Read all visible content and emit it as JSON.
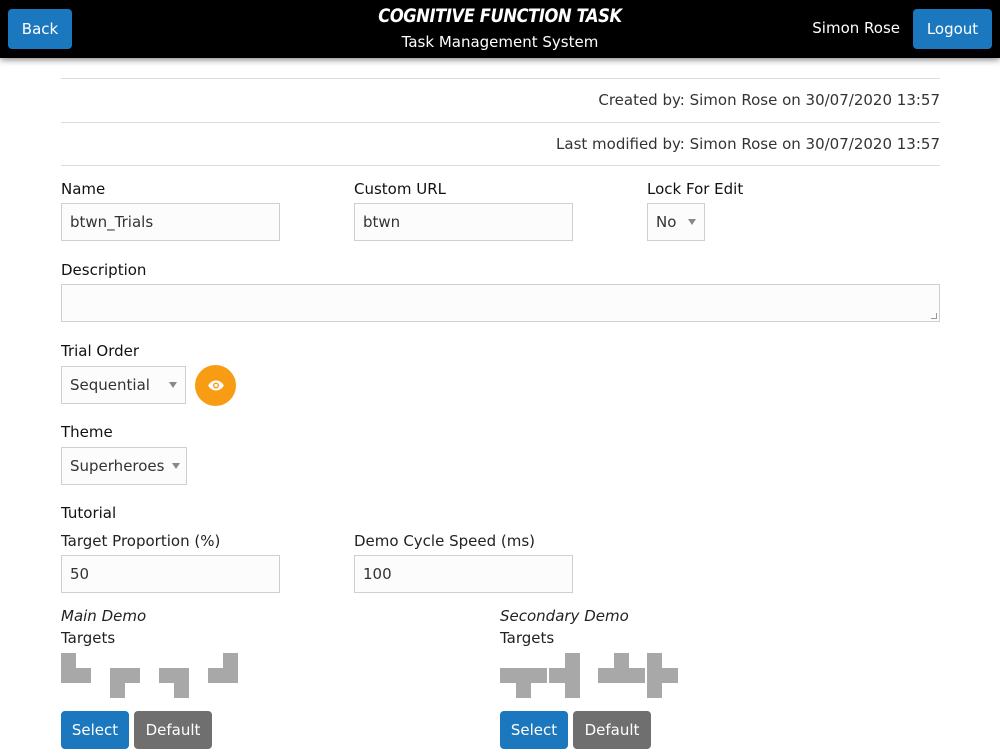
{
  "header": {
    "back_label": "Back",
    "app_title": "COGNITIVE FUNCTION TASK",
    "app_subtitle": "Task Management System",
    "user_name": "Simon Rose",
    "logout_label": "Logout"
  },
  "meta": {
    "created": "Created by: Simon Rose on 30/07/2020 13:57",
    "modified": "Last modified by: Simon Rose on 30/07/2020 13:57"
  },
  "form": {
    "name_label": "Name",
    "name_value": "btwn_Trials",
    "custom_url_label": "Custom URL",
    "custom_url_value": "btwn",
    "lock_label": "Lock For Edit",
    "lock_value": "No",
    "description_label": "Description",
    "description_value": "",
    "trial_order_label": "Trial Order",
    "trial_order_value": "Sequential",
    "theme_label": "Theme",
    "theme_value": "Superheroes",
    "tutorial_label": "Tutorial",
    "target_proportion_label": "Target Proportion (%)",
    "target_proportion_value": "50",
    "demo_speed_label": "Demo Cycle Speed (ms)",
    "demo_speed_value": "100"
  },
  "demos": {
    "main": {
      "title": "Main Demo",
      "targets_label": "Targets",
      "select_label": "Select",
      "default_label": "Default",
      "shapes": [
        "L-bottom-right",
        "L-top-right",
        "L-top-left",
        "L-bottom-left"
      ]
    },
    "secondary": {
      "title": "Secondary Demo",
      "targets_label": "Targets",
      "select_label": "Select",
      "default_label": "Default",
      "shapes": [
        "T-down",
        "T-left",
        "T-up",
        "T-right"
      ]
    }
  },
  "colors": {
    "primary": "#1c78be",
    "secondary": "#6f6f6f",
    "accent": "#f89c13",
    "shape": "#a8a8a8"
  }
}
